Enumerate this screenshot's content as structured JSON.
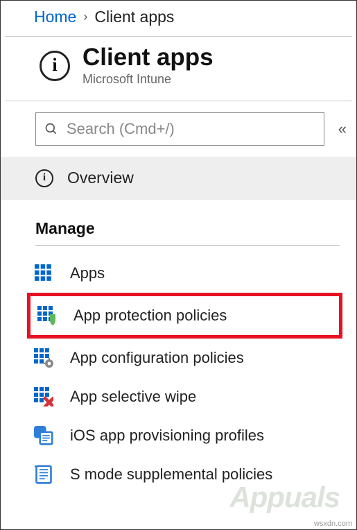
{
  "breadcrumb": {
    "home": "Home",
    "current": "Client apps"
  },
  "header": {
    "title": "Client apps",
    "subtitle": "Microsoft Intune"
  },
  "search": {
    "placeholder": "Search (Cmd+/)"
  },
  "overview": {
    "label": "Overview"
  },
  "section": {
    "manage": {
      "heading": "Manage",
      "items": [
        {
          "label": "Apps",
          "icon": "grid-icon",
          "highlighted": false
        },
        {
          "label": "App protection policies",
          "icon": "grid-shield-icon",
          "highlighted": true
        },
        {
          "label": "App configuration policies",
          "icon": "grid-gear-icon",
          "highlighted": false
        },
        {
          "label": "App selective wipe",
          "icon": "grid-xred-icon",
          "highlighted": false
        },
        {
          "label": "iOS app provisioning profiles",
          "icon": "profile-doc-icon",
          "highlighted": false
        },
        {
          "label": "S mode supplemental policies",
          "icon": "scroll-icon",
          "highlighted": false
        }
      ]
    }
  },
  "watermark": "Appuals",
  "source": "wsxdn.com"
}
